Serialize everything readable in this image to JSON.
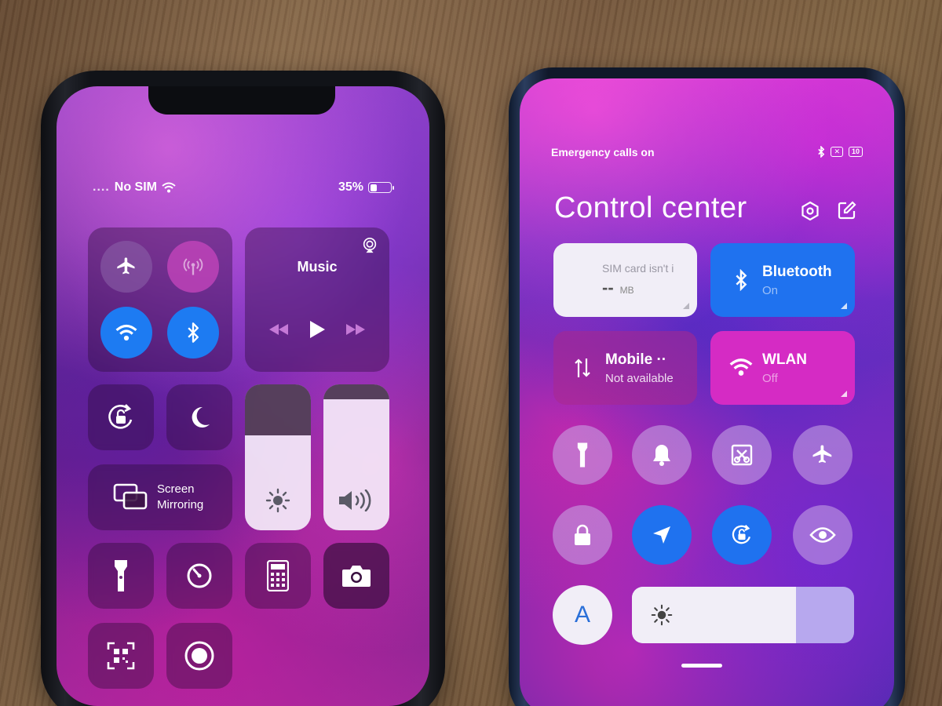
{
  "iphone": {
    "status": {
      "carrier_dots": "....",
      "carrier": "No SIM",
      "battery": "35%",
      "battery_level": 0.35
    },
    "connectivity": {
      "airplane": "airplane-icon",
      "cellular": "cellular-antenna-icon",
      "wifi": "wifi-icon",
      "bluetooth": "bluetooth-icon"
    },
    "music": {
      "title": "Music"
    },
    "screen_mirroring": {
      "label_line1": "Screen",
      "label_line2": "Mirroring"
    },
    "brightness_level": 0.65,
    "volume_level": 0.9
  },
  "mi": {
    "status": {
      "left": "Emergency calls on",
      "battery": "10"
    },
    "title": "Control center",
    "cards": {
      "sim": {
        "title": "SIM card isn't i",
        "value": "--",
        "unit": "MB"
      },
      "bluetooth": {
        "title": "Bluetooth",
        "sub": "On"
      },
      "mobile": {
        "title": "Mobile ··",
        "sub": "Not available"
      },
      "wlan": {
        "title": "WLAN",
        "sub": "Off"
      }
    },
    "auto_brightness_label": "A",
    "brightness_level": 0.74,
    "colors": {
      "accent_blue": "#1f72ef",
      "wlan_card": "#d52bc4",
      "light_card": "#f1eef7"
    }
  }
}
